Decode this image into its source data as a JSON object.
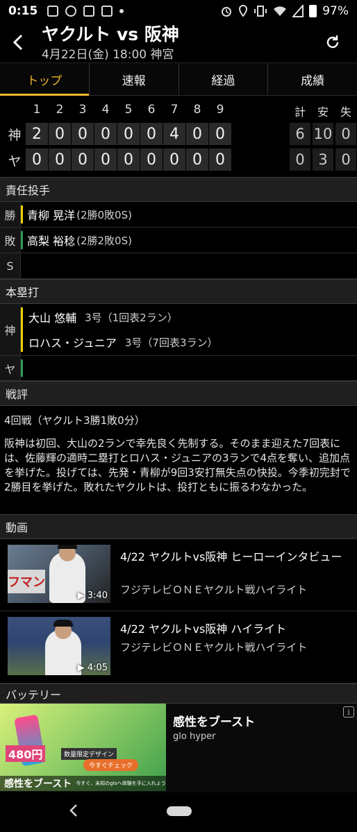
{
  "status_bar": {
    "time": "0:15",
    "battery": "97%"
  },
  "header": {
    "title": "ヤクルト vs 阪神",
    "subtitle": "4月22日(金) 18:00 神宮"
  },
  "tabs": [
    {
      "label": "トップ",
      "active": true
    },
    {
      "label": "速報"
    },
    {
      "label": "経過"
    },
    {
      "label": "成績"
    }
  ],
  "scoreboard": {
    "innings": [
      "1",
      "2",
      "3",
      "4",
      "5",
      "6",
      "7",
      "8",
      "9"
    ],
    "total_headers": [
      "計",
      "安",
      "失"
    ],
    "rows": [
      {
        "team": "神",
        "scores": [
          "2",
          "0",
          "0",
          "0",
          "0",
          "0",
          "4",
          "0",
          "0"
        ],
        "totals": [
          "6",
          "10",
          "0"
        ]
      },
      {
        "team": "ヤ",
        "scores": [
          "0",
          "0",
          "0",
          "0",
          "0",
          "0",
          "0",
          "0",
          "0"
        ],
        "totals": [
          "0",
          "3",
          "0"
        ]
      }
    ]
  },
  "pitchers": {
    "header": "責任投手",
    "win": {
      "label": "勝",
      "name": "青柳 晃洋",
      "record": "(2勝0敗0S)"
    },
    "loss": {
      "label": "敗",
      "name": "高梨 裕稔",
      "record": "(2勝2敗0S)"
    },
    "save": {
      "label": "S",
      "name": "",
      "record": ""
    }
  },
  "home_runs": {
    "header": "本塁打",
    "hanshin": {
      "label": "神",
      "entries": [
        {
          "name": "大山 悠輔",
          "detail": "3号（1回表2ラン）"
        },
        {
          "name": "ロハス・ジュニア",
          "detail": "3号（7回表3ラン）"
        }
      ]
    },
    "yakult": {
      "label": "ヤ"
    }
  },
  "review": {
    "header": "戦評",
    "series": "4回戦（ヤクルト3勝1敗0分）",
    "body": "阪神は初回、大山の2ランで幸先良く先制する。そのまま迎えた7回表には、佐藤輝の適時二塁打とロハス・ジュニアの3ランで4点を奪い、追加点を挙げた。投げては、先発・青柳が9回3安打無失点の快投。今季初完封で2勝目を挙げた。敗れたヤクルトは、投打ともに振るわなかった。"
  },
  "videos": {
    "header": "動画",
    "items": [
      {
        "title": "4/22 ヤクルトvs阪神 ヒーローインタビュー",
        "source": "フジテレビＯＮＥヤクルト戦ハイライト",
        "duration": "▶ 3:40",
        "thumb_text": "フマン"
      },
      {
        "title": "4/22 ヤクルトvs阪神 ハイライト",
        "source": "フジテレビＯＮＥヤクルト戦ハイライト",
        "duration": "▶ 4:05"
      }
    ]
  },
  "battery_section": {
    "header": "バッテリー"
  },
  "ad": {
    "title": "感性をブースト",
    "brand": "glo hyper",
    "image_price": "480円",
    "image_badge": "数量限定デザイン",
    "image_button": "今すぐチェック",
    "image_copy": "感性をブースト",
    "image_small": "今すぐ、未知のgloへ体験を手に入れよう",
    "info": "i"
  },
  "colors": {
    "accent": "#f0b62a",
    "win_bar": "#f0d000",
    "loss_bar": "#2e9a5a"
  }
}
